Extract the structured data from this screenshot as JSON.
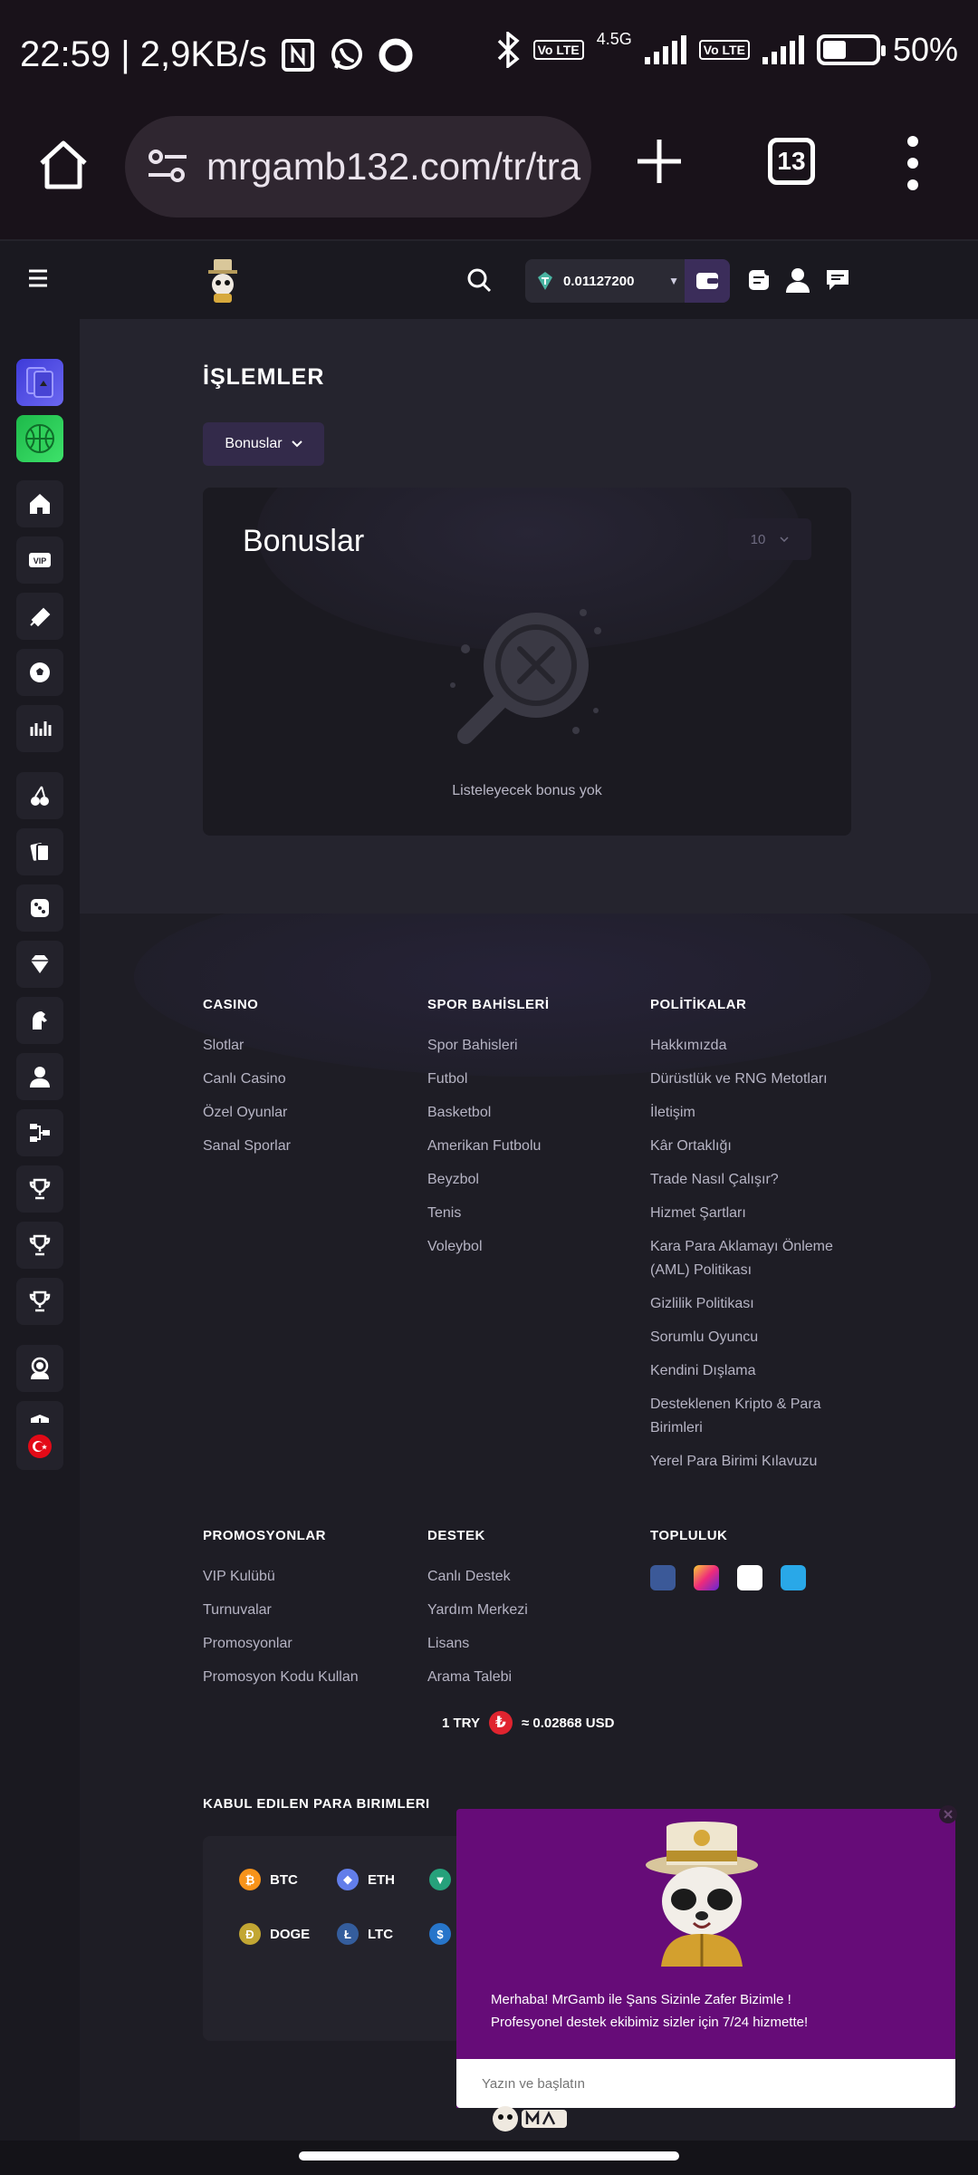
{
  "status_bar": {
    "time_speed": "22:59 | 2,9KB/s",
    "network": "4.5G",
    "volte": "Vo LTE",
    "battery": "50%",
    "battery_level": 0.45
  },
  "browser": {
    "url": "mrgamb132.com/tr/tra",
    "tab_count": "13"
  },
  "header": {
    "balance": "0.01127200"
  },
  "main": {
    "title": "İŞLEMLER",
    "filter_label": "Bonuslar",
    "card_title": "Bonuslar",
    "page_size": "10",
    "empty_text": "Listeleyecek bonus yok"
  },
  "footer": {
    "casino": {
      "heading": "CASINO",
      "links": [
        "Slotlar",
        "Canlı Casino",
        "Özel Oyunlar",
        "Sanal Sporlar"
      ]
    },
    "sports": {
      "heading": "SPOR BAHİSLERİ",
      "links": [
        "Spor Bahisleri",
        "Futbol",
        "Basketbol",
        "Amerikan Futbolu",
        "Beyzbol",
        "Tenis",
        "Voleybol"
      ]
    },
    "policies": {
      "heading": "POLİTİKALAR",
      "links": [
        "Hakkımızda",
        "Dürüstlük ve RNG Metotları",
        "İletişim",
        "Kâr Ortaklığı",
        "Trade Nasıl Çalışır?",
        "Hizmet Şartları",
        "Kara Para Aklamayı Önleme (AML) Politikası",
        "Gizlilik Politikası",
        "Sorumlu Oyuncu",
        "Kendini Dışlama",
        "Desteklenen Kripto & Para Birimleri",
        "Yerel Para Birimi Kılavuzu"
      ]
    },
    "promotions": {
      "heading": "PROMOSYONLAR",
      "links": [
        "VIP Kulübü",
        "Turnuvalar",
        "Promosyonlar",
        "Promosyon Kodu Kullan"
      ]
    },
    "support": {
      "heading": "DESTEK",
      "links": [
        "Canlı Destek",
        "Yardım Merkezi",
        "Lisans",
        "Arama Talebi"
      ]
    },
    "community": {
      "heading": "TOPLULUK",
      "icons": [
        "facebook-icon",
        "instagram-icon",
        "x-icon",
        "telegram-icon"
      ]
    },
    "rate_left": "1 TRY",
    "rate_right": "≈ 0.02868 USD",
    "currencies_heading": "KABUL EDILEN PARA BIRIMLERI",
    "currencies": [
      "BTC",
      "ETH",
      "DOGE",
      "LTC"
    ]
  },
  "chat": {
    "line1": "Merhaba! MrGamb ile Şans Sizinle Zafer Bizimle !",
    "line2": "Profesyonel destek ekibimiz sizler için 7/24 hizmette!",
    "placeholder": "Yazın ve başlatın"
  },
  "colors": {
    "accent": "#332a4a",
    "chat_bg": "#660c78",
    "page_bg": "#25242e"
  }
}
